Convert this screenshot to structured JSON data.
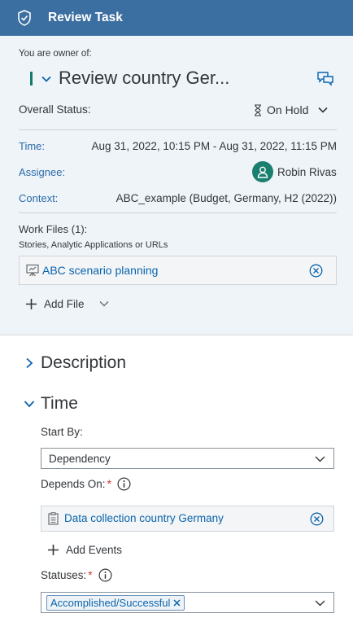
{
  "header": {
    "title": "Review Task",
    "icon": "shield-check-icon",
    "background": "#3c6fa1"
  },
  "task": {
    "owner_text": "You are owner of:",
    "title": "Review country Ger...",
    "overall_status_label": "Overall Status:",
    "status_value": "On Hold"
  },
  "details": {
    "time_label": "Time:",
    "time_value": "Aug 31, 2022, 10:15 PM - Aug 31, 2022, 11:15 PM",
    "assignee_label": "Assignee:",
    "assignee_name": "Robin Rivas",
    "context_label": "Context:",
    "context_value": "ABC_example (Budget, Germany, H2 (2022))"
  },
  "work_files": {
    "title": "Work Files (1):",
    "subtitle": "Stories, Analytic Applications or URLs",
    "files": [
      {
        "name": "ABC scenario planning",
        "icon": "presentation-icon"
      }
    ],
    "add_label": "Add File"
  },
  "sections": {
    "description": "Description",
    "time": "Time"
  },
  "time_section": {
    "start_by_label": "Start By:",
    "start_by_value": "Dependency",
    "depends_on_label": "Depends On:",
    "required_mark": "*",
    "depends_on_item": "Data collection country Germany",
    "add_events_label": "Add Events",
    "statuses_label": "Statuses:",
    "status_token": "Accomplished/Successful"
  },
  "colors": {
    "link": "#0a64ad",
    "label_blue": "#2a6aa8",
    "accent_teal": "#1b7f6f",
    "required": "#d1322c",
    "panel_bg": "#eff4f9"
  }
}
